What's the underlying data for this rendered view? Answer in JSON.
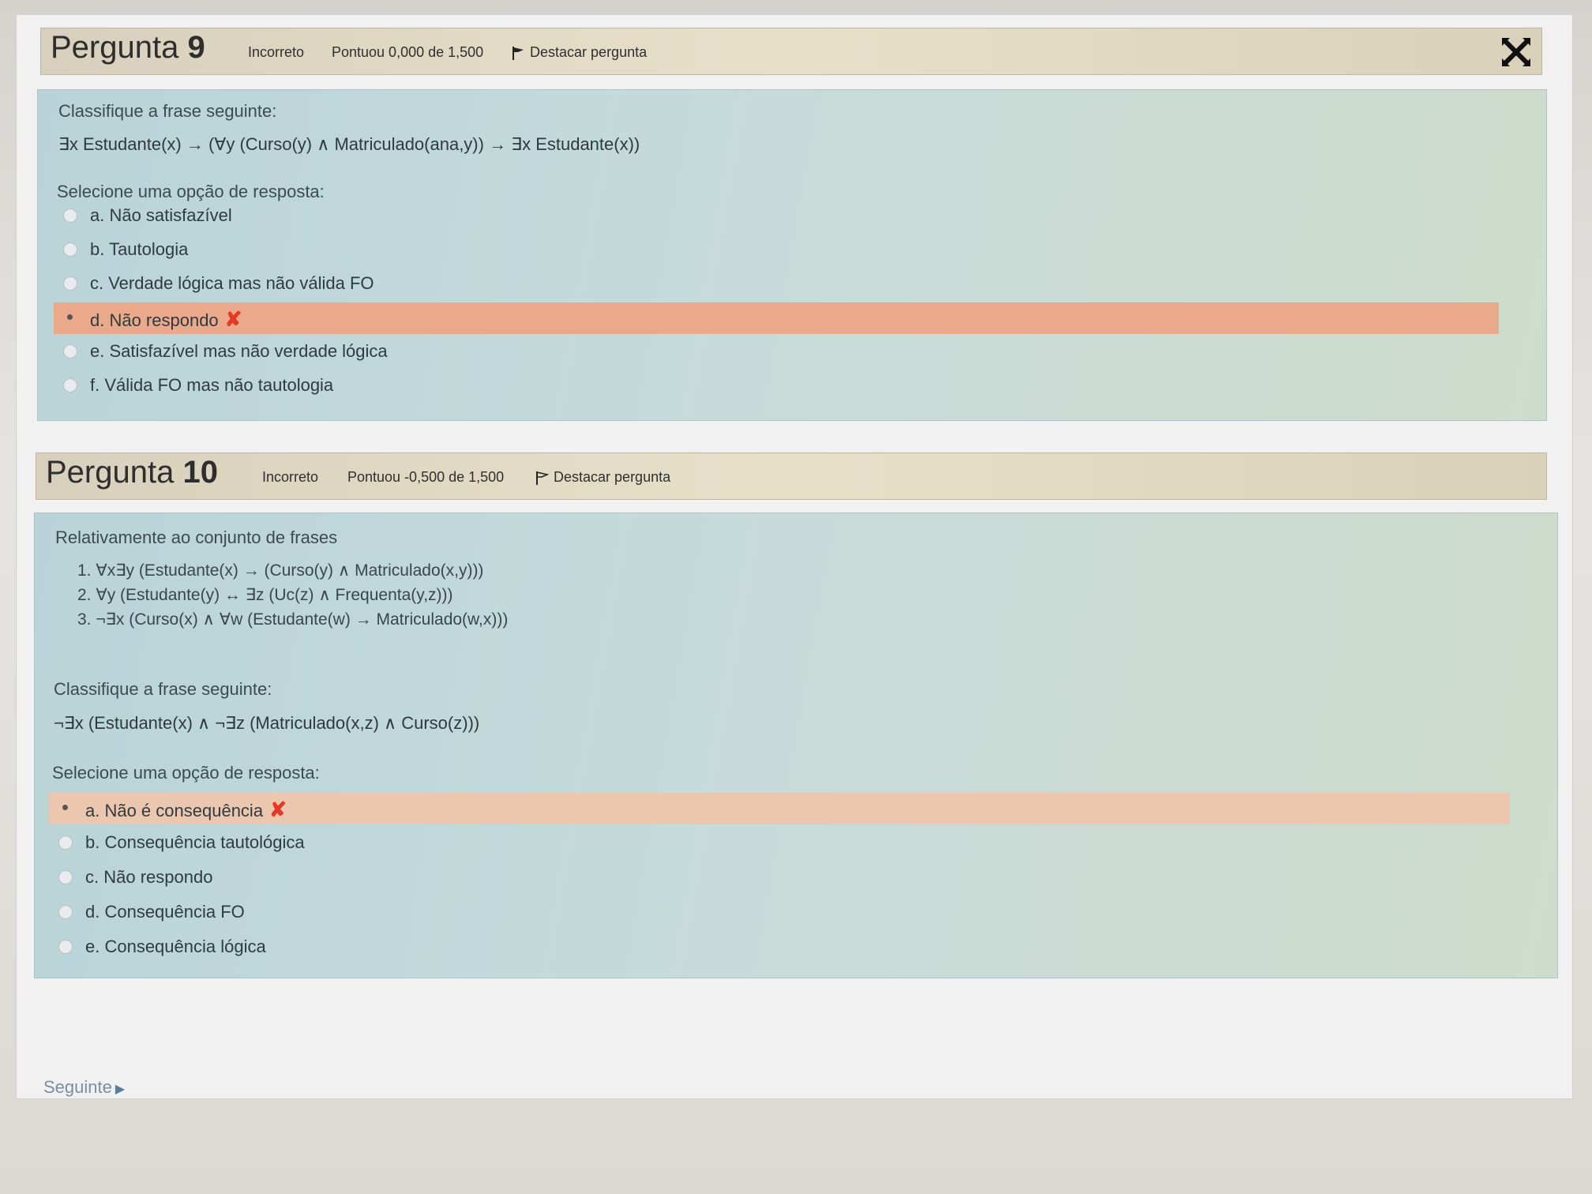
{
  "q9": {
    "title_prefix": "Pergunta",
    "title_number": "9",
    "status": "Incorreto",
    "score": "Pontuou 0,000 de 1,500",
    "flag_label": "Destacar pergunta",
    "prompt": "Classifique a frase seguinte:",
    "formula": "∃x Estudante(x) → (∀y (Curso(y) ∧ Matriculado(ana,y)) → ∃x Estudante(x))",
    "select_label": "Selecione uma opção de resposta:",
    "options": [
      {
        "label": "a. Não satisfazível"
      },
      {
        "label": "b. Tautologia"
      },
      {
        "label": "c. Verdade lógica mas não válida FO"
      },
      {
        "label": "d. Não respondo",
        "selected": true,
        "wrong_mark": "✘"
      },
      {
        "label": "e. Satisfazível mas não verdade lógica"
      },
      {
        "label": "f. Válida FO mas não tautologia"
      }
    ]
  },
  "q10": {
    "title_prefix": "Pergunta",
    "title_number": "10",
    "status": "Incorreto",
    "score": "Pontuou -0,500 de 1,500",
    "flag_label": "Destacar pergunta",
    "intro": "Relativamente ao conjunto de frases",
    "sentences": [
      "1. ∀x∃y (Estudante(x) → (Curso(y) ∧ Matriculado(x,y)))",
      "2. ∀y (Estudante(y)  ↔ ∃z (Uc(z) ∧ Frequenta(y,z)))",
      "3. ¬∃x (Curso(x) ∧ ∀w (Estudante(w) → Matriculado(w,x)))"
    ],
    "prompt": "Classifique a frase seguinte:",
    "formula": "¬∃x (Estudante(x) ∧ ¬∃z (Matriculado(x,z) ∧ Curso(z)))",
    "select_label": "Selecione uma opção de resposta:",
    "options": [
      {
        "label": "a. Não é consequência",
        "selected": true,
        "wrong_mark": "✘"
      },
      {
        "label": "b. Consequência tautológica"
      },
      {
        "label": "c. Não respondo"
      },
      {
        "label": "d. Consequência FO"
      },
      {
        "label": "e. Consequência lógica"
      }
    ]
  },
  "nav": {
    "next_label": "Seguinte",
    "next_arrow": "▶"
  },
  "colors": {
    "header_bg": "#e2dac4",
    "answer_bg": "#c3dadb",
    "selected_wrong_bg": "#e9a98a",
    "wrong_mark": "#e23a25"
  }
}
